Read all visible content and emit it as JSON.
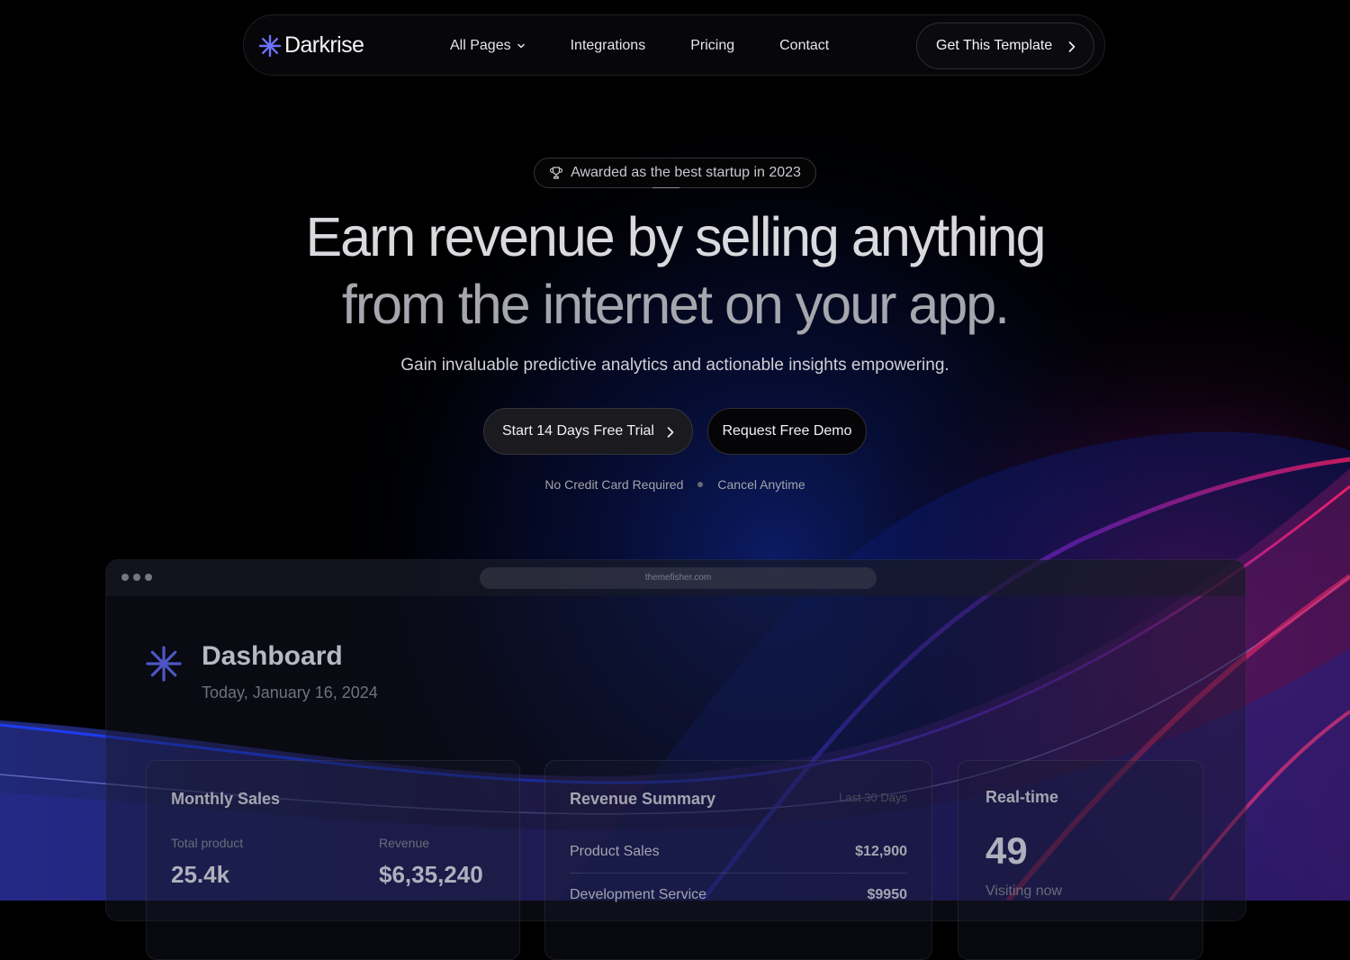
{
  "nav": {
    "brand": "Darkrise",
    "links": [
      {
        "label": "All Pages",
        "dropdown": true
      },
      {
        "label": "Integrations"
      },
      {
        "label": "Pricing"
      },
      {
        "label": "Contact"
      }
    ],
    "cta_label": "Get This Template"
  },
  "hero": {
    "badge_text": "Awarded as the best startup in 2023",
    "headline_line1": "Earn revenue by selling anything",
    "headline_line2": "from the internet on your app.",
    "subheadline": "Gain invaluable predictive analytics and actionable insights empowering.",
    "primary_button": "Start 14 Days Free Trial",
    "secondary_button": "Request Free Demo",
    "notes": [
      "No Credit Card Required",
      "Cancel Anytime"
    ]
  },
  "preview": {
    "url": "themefisher.com",
    "dashboard_title": "Dashboard",
    "dashboard_date": "Today, January 16, 2024",
    "monthly_sales": {
      "title": "Monthly Sales",
      "metrics": [
        {
          "label": "Total product",
          "value": "25.4k"
        },
        {
          "label": "Revenue",
          "value": "$6,35,240"
        }
      ]
    },
    "revenue_summary": {
      "title": "Revenue Summary",
      "period": "Last 30 Days",
      "rows": [
        {
          "label": "Product Sales",
          "value": "$12,900"
        },
        {
          "label": "Development Service",
          "value": "$9950"
        }
      ]
    },
    "realtime": {
      "title": "Real-time",
      "value": "49",
      "label": "Visiting now"
    }
  },
  "colors": {
    "accent": "#6b72ff",
    "background": "#000000",
    "wave_blue": "#1e3cff",
    "wave_magenta": "#e0104e"
  },
  "icons": [
    "asterisk-logo-icon",
    "chevron-down-icon",
    "chevron-right-icon",
    "trophy-icon"
  ]
}
